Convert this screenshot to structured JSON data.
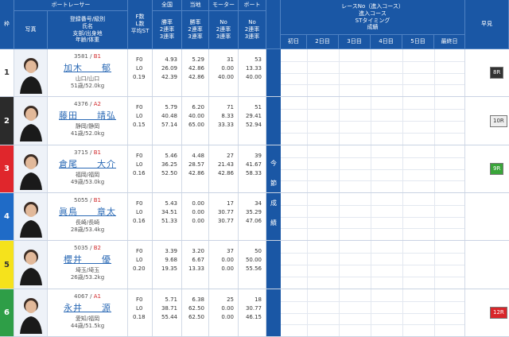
{
  "header": {
    "waku": "枠",
    "boat_racer": "ボートレーサー",
    "photo": "写真",
    "reg_lines": [
      "登録番号/級別",
      "氏名",
      "支部/出身地",
      "年齢/体重"
    ],
    "f_lines": [
      "F数",
      "L数",
      "平均ST"
    ],
    "zenkoku": "全国",
    "touchi": "当地",
    "motor": "モーター",
    "boat": "ボート",
    "rate_lines": [
      "勝率",
      "2連率",
      "3連率"
    ],
    "no_lines": [
      "No",
      "2連率",
      "3連率"
    ],
    "race_lines": [
      "レースNo（進入コース）",
      "進入コース",
      "STタイミング",
      "成績"
    ],
    "days": [
      "初日",
      "2日目",
      "3日目",
      "4日目",
      "5日目",
      "最終日"
    ],
    "hayami": "早見"
  },
  "side_label": [
    "今",
    "節",
    "成",
    "績"
  ],
  "colors": {
    "header_bg": "#1a57a5",
    "accent": "#2a69b5"
  },
  "racers": [
    {
      "waku": "1",
      "waku_color": "#ffffff",
      "waku_text": "#333333",
      "reg": "3581",
      "cls": "B1",
      "name": "加木　　郁",
      "branch": "山口/山口",
      "age_weight": "51歳/52.0kg",
      "f": "F0",
      "l": "L0",
      "st": "0.19",
      "zenkoku": [
        "4.93",
        "26.09",
        "42.39"
      ],
      "touchi": [
        "5.29",
        "42.86",
        "42.86"
      ],
      "motor": [
        "31",
        "0.00",
        "40.00"
      ],
      "boat": [
        "53",
        "13.33",
        "40.00"
      ],
      "badge": "8R",
      "badge_bg": "#333333",
      "badge_fg": "#ffffff"
    },
    {
      "waku": "2",
      "waku_color": "#2b2b2b",
      "waku_text": "#ffffff",
      "reg": "4376",
      "cls": "A2",
      "name": "藤田　　靖弘",
      "branch": "静岡/静岡",
      "age_weight": "41歳/52.0kg",
      "f": "F0",
      "l": "L0",
      "st": "0.15",
      "zenkoku": [
        "5.79",
        "40.48",
        "57.14"
      ],
      "touchi": [
        "6.20",
        "40.00",
        "65.00"
      ],
      "motor": [
        "71",
        "8.33",
        "33.33"
      ],
      "boat": [
        "51",
        "29.41",
        "52.94"
      ],
      "badge": "10R",
      "badge_bg": "#eeeeee",
      "badge_fg": "#333333"
    },
    {
      "waku": "3",
      "waku_color": "#e0262c",
      "waku_text": "#ffffff",
      "reg": "3715",
      "cls": "B1",
      "name": "倉尾　　大介",
      "branch": "福岡/福岡",
      "age_weight": "49歳/53.0kg",
      "f": "F0",
      "l": "L0",
      "st": "0.16",
      "zenkoku": [
        "5.46",
        "36.25",
        "52.50"
      ],
      "touchi": [
        "4.48",
        "28.57",
        "42.86"
      ],
      "motor": [
        "27",
        "21.43",
        "42.86"
      ],
      "boat": [
        "39",
        "41.67",
        "58.33"
      ],
      "badge": "9R",
      "badge_bg": "#3aa53a",
      "badge_fg": "#ffffff"
    },
    {
      "waku": "4",
      "waku_color": "#1f6bc7",
      "waku_text": "#ffffff",
      "reg": "5055",
      "cls": "B1",
      "name": "眞鳥　　章太",
      "branch": "長崎/長崎",
      "age_weight": "28歳/53.4kg",
      "f": "F0",
      "l": "L0",
      "st": "0.16",
      "zenkoku": [
        "5.43",
        "34.51",
        "51.33"
      ],
      "touchi": [
        "0.00",
        "0.00",
        "0.00"
      ],
      "motor": [
        "17",
        "30.77",
        "30.77"
      ],
      "boat": [
        "34",
        "35.29",
        "47.06"
      ],
      "badge": "",
      "badge_bg": "",
      "badge_fg": ""
    },
    {
      "waku": "5",
      "waku_color": "#f5e21c",
      "waku_text": "#333333",
      "reg": "5035",
      "cls": "B2",
      "name": "櫻井　　優",
      "branch": "埼玉/埼玉",
      "age_weight": "26歳/53.2kg",
      "f": "F0",
      "l": "L0",
      "st": "0.20",
      "zenkoku": [
        "3.39",
        "9.68",
        "19.35"
      ],
      "touchi": [
        "3.20",
        "6.67",
        "13.33"
      ],
      "motor": [
        "37",
        "0.00",
        "0.00"
      ],
      "boat": [
        "50",
        "50.00",
        "55.56"
      ],
      "badge": "",
      "badge_bg": "",
      "badge_fg": ""
    },
    {
      "waku": "6",
      "waku_color": "#2e9e47",
      "waku_text": "#ffffff",
      "reg": "4067",
      "cls": "A1",
      "name": "永井　　源",
      "branch": "愛知/福岡",
      "age_weight": "44歳/51.5kg",
      "f": "F0",
      "l": "L0",
      "st": "0.18",
      "zenkoku": [
        "5.71",
        "38.71",
        "55.44"
      ],
      "touchi": [
        "6.38",
        "62.50",
        "62.50"
      ],
      "motor": [
        "25",
        "0.00",
        "0.00"
      ],
      "boat": [
        "18",
        "30.77",
        "46.15"
      ],
      "badge": "12R",
      "badge_bg": "#d8262a",
      "badge_fg": "#ffffff"
    }
  ]
}
